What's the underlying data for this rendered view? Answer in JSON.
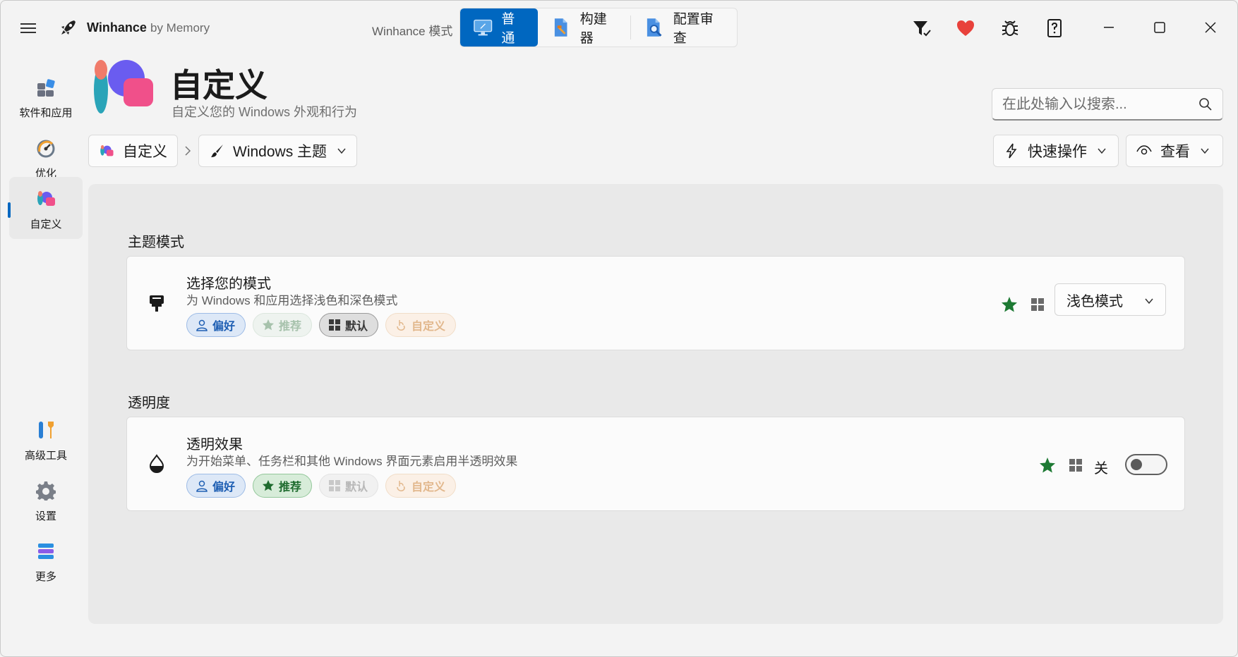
{
  "app": {
    "name": "Winhance",
    "by": "by Memory"
  },
  "modes": {
    "label": "Winhance 模式",
    "items": [
      {
        "label": "普通",
        "icon": "monitor-icon",
        "active": true
      },
      {
        "label": "构建器",
        "icon": "document-build-icon",
        "active": false
      },
      {
        "label": "配置审查",
        "icon": "document-search-icon",
        "active": false
      }
    ]
  },
  "titlebar_icons": [
    "filter-check-icon",
    "heart-icon",
    "bug-icon",
    "help-book-icon"
  ],
  "sidebar": {
    "items": [
      {
        "label": "软件和应用",
        "icon": "apps-icon"
      },
      {
        "label": "优化",
        "icon": "speedometer-icon"
      },
      {
        "label": "自定义",
        "icon": "palette-icon",
        "active": true
      },
      {
        "label": "高级工具",
        "icon": "tools-icon"
      },
      {
        "label": "设置",
        "icon": "gear-icon"
      },
      {
        "label": "更多",
        "icon": "more-list-icon"
      }
    ]
  },
  "header": {
    "title": "自定义",
    "subtitle": "自定义您的 Windows 外观和行为"
  },
  "search": {
    "placeholder": "在此处输入以搜索..."
  },
  "breadcrumb": {
    "root": "自定义",
    "current": "Windows 主题"
  },
  "actions": {
    "quick": "快速操作",
    "view": "查看"
  },
  "sections": [
    {
      "title": "主题模式",
      "setting": {
        "title": "选择您的模式",
        "description": "为 Windows 和应用选择浅色和深色模式",
        "tags": [
          "偏好",
          "推荐",
          "默认",
          "自定义"
        ],
        "value": "浅色模式"
      }
    },
    {
      "title": "透明度",
      "setting": {
        "title": "透明效果",
        "description": "为开始菜单、任务栏和其他 Windows 界面元素启用半透明效果",
        "tags": [
          "偏好",
          "推荐",
          "默认",
          "自定义"
        ],
        "toggle_label": "关",
        "toggle_on": false
      }
    }
  ],
  "colors": {
    "accent": "#0067c0",
    "recommended_green": "#1e7a34",
    "heart_red": "#e8413b"
  }
}
